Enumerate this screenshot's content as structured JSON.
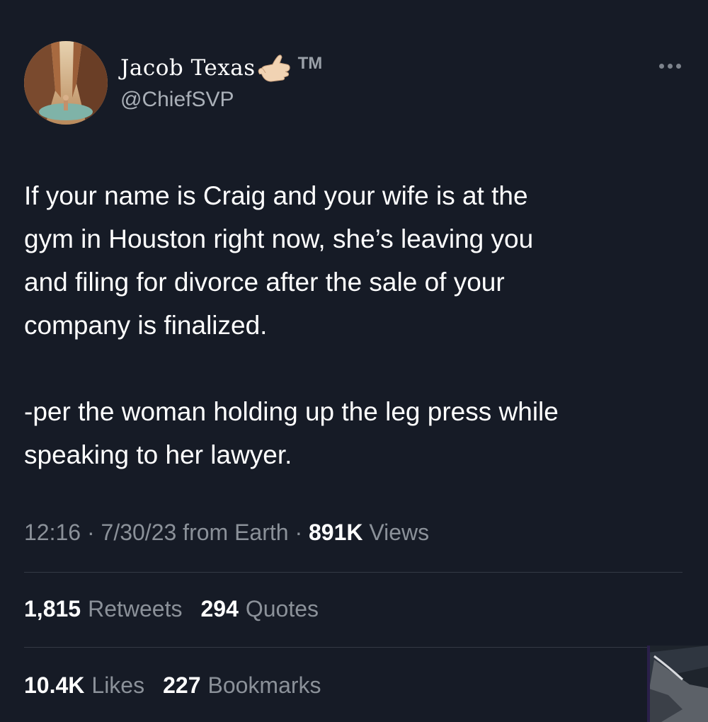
{
  "author": {
    "display_name": "Jacob Texas",
    "trademark": "TM",
    "handle": "@ChiefSVP",
    "avatar_icon": "canyon-person-avatar",
    "badge_icon": "call-me-hand-icon"
  },
  "tweet": {
    "lines": [
      "If your name is Craig and your wife is at the",
      "gym in Houston right now, she’s leaving you",
      "and filing for divorce after the sale of your",
      "company is finalized."
    ],
    "signoff_lines": [
      "-per the woman holding up the leg press while",
      "speaking to her lawyer."
    ]
  },
  "meta": {
    "time": "12:16",
    "date": "7/30/23",
    "source": "from Earth",
    "views_count": "891K",
    "views_label": "Views"
  },
  "stats": {
    "retweets_count": "1,815",
    "retweets_label": "Retweets",
    "quotes_count": "294",
    "quotes_label": "Quotes",
    "likes_count": "10.4K",
    "likes_label": "Likes",
    "bookmarks_count": "227",
    "bookmarks_label": "Bookmarks"
  },
  "colors": {
    "background": "#161b26",
    "text": "#ffffff",
    "muted": "#8b9199",
    "divider": "#343a45"
  }
}
